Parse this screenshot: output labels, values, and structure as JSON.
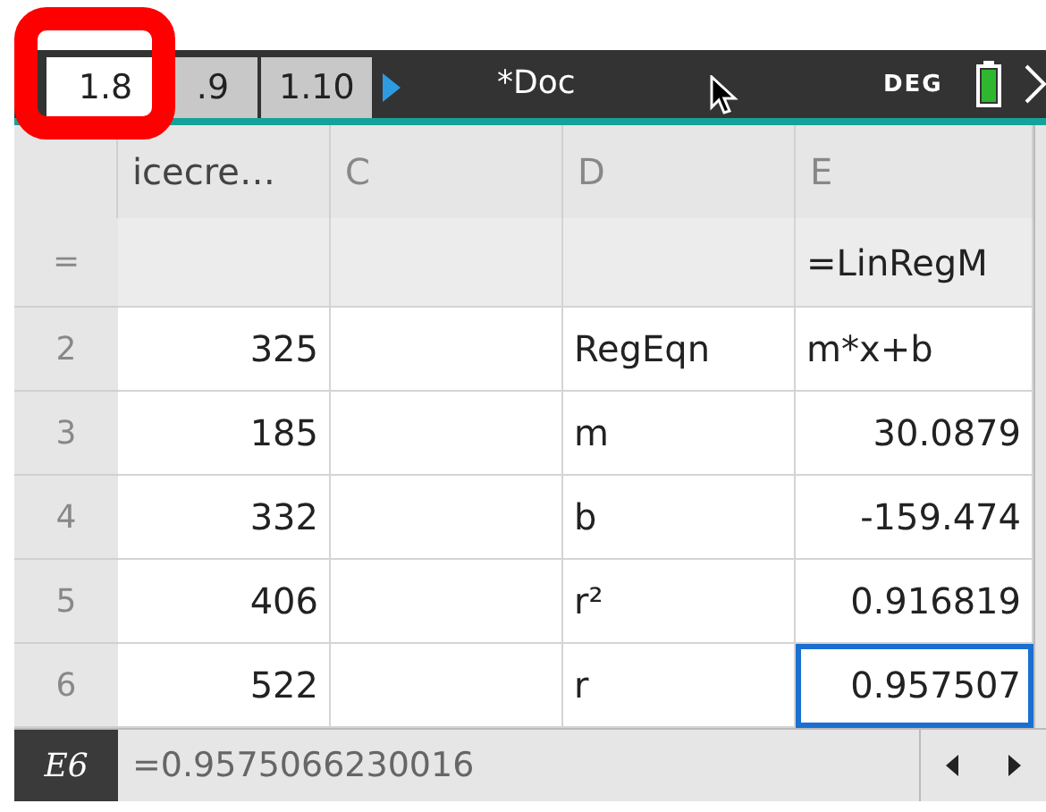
{
  "tabs": [
    {
      "label": "1.8",
      "selected": true
    },
    {
      "label": ".9",
      "selected": false
    },
    {
      "label": "1.10",
      "selected": false
    }
  ],
  "document_title": "*Doc",
  "angle_mode": "DEG",
  "columns": [
    {
      "label": "icecre…"
    },
    {
      "label": "C"
    },
    {
      "label": "D"
    },
    {
      "label": "E"
    }
  ],
  "formula_row": {
    "marker": "=",
    "cells": [
      "",
      "",
      "",
      "=LinRegM"
    ]
  },
  "rows": [
    {
      "number": "2",
      "cells": [
        {
          "text": "325",
          "selected": false
        },
        {
          "text": "",
          "selected": false
        },
        {
          "text": "RegEqn",
          "selected": false
        },
        {
          "text": "m*x+b",
          "selected": false
        }
      ]
    },
    {
      "number": "3",
      "cells": [
        {
          "text": "185",
          "selected": false
        },
        {
          "text": "",
          "selected": false
        },
        {
          "text": "m",
          "selected": false
        },
        {
          "text": "30.0879",
          "selected": false
        }
      ]
    },
    {
      "number": "4",
      "cells": [
        {
          "text": "332",
          "selected": false
        },
        {
          "text": "",
          "selected": false
        },
        {
          "text": "b",
          "selected": false
        },
        {
          "text": "-159.474",
          "selected": false
        }
      ]
    },
    {
      "number": "5",
      "cells": [
        {
          "text": "406",
          "selected": false
        },
        {
          "text": "",
          "selected": false
        },
        {
          "text": "r²",
          "selected": false
        },
        {
          "text": "0.916819",
          "selected": false
        }
      ]
    },
    {
      "number": "6",
      "cells": [
        {
          "text": "522",
          "selected": false
        },
        {
          "text": "",
          "selected": false
        },
        {
          "text": "r",
          "selected": false
        },
        {
          "text": "0.957507",
          "selected": true
        }
      ]
    }
  ],
  "status_bar": {
    "cell_ref": "E6",
    "value": "=0.9575066230016"
  }
}
